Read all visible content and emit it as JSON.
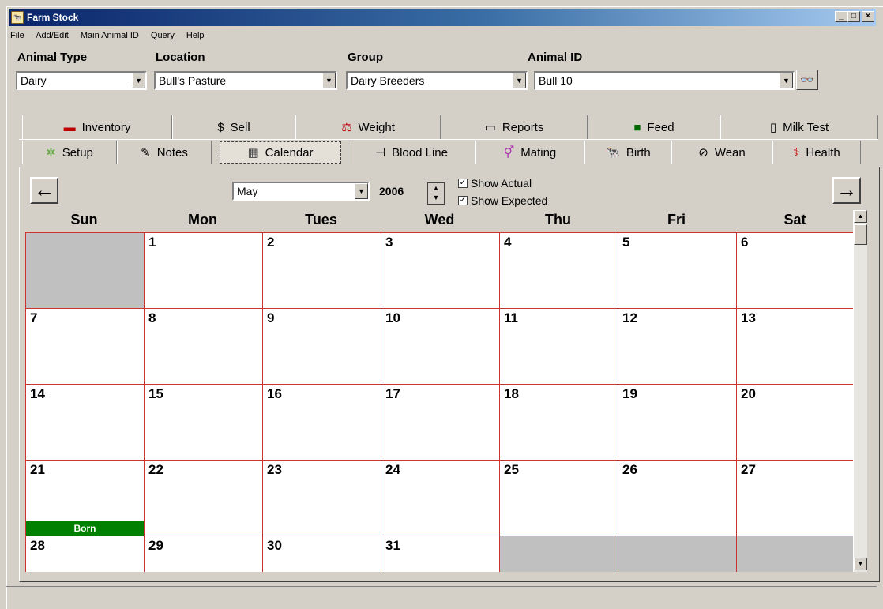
{
  "window": {
    "title": "Farm Stock"
  },
  "menu": [
    "File",
    "Add/Edit",
    "Main Animal ID",
    "Query",
    "Help"
  ],
  "filters": {
    "animal_type": {
      "label": "Animal Type",
      "value": "Dairy"
    },
    "location": {
      "label": "Location",
      "value": "Bull's Pasture"
    },
    "group": {
      "label": "Group",
      "value": "Dairy Breeders"
    },
    "animal_id": {
      "label": "Animal ID",
      "value": "Bull 10"
    }
  },
  "tabs_top": [
    "Inventory",
    "Sell",
    "Weight",
    "Reports",
    "Feed",
    "Milk Test"
  ],
  "tabs_bottom": [
    "Setup",
    "Notes",
    "Calendar",
    "Blood Line",
    "Mating",
    "Birth",
    "Wean",
    "Health"
  ],
  "calendar": {
    "month": "May",
    "year": "2006",
    "show_actual_label": "Show Actual",
    "show_expected_label": "Show Expected",
    "show_actual": true,
    "show_expected": true,
    "days": [
      "Sun",
      "Mon",
      "Tues",
      "Wed",
      "Thu",
      "Fri",
      "Sat"
    ],
    "weeks": [
      [
        "",
        "1",
        "2",
        "3",
        "4",
        "5",
        "6"
      ],
      [
        "7",
        "8",
        "9",
        "10",
        "11",
        "12",
        "13"
      ],
      [
        "14",
        "15",
        "16",
        "17",
        "18",
        "19",
        "20"
      ],
      [
        "21",
        "22",
        "23",
        "24",
        "25",
        "26",
        "27"
      ],
      [
        "28",
        "29",
        "30",
        "31",
        "",
        "",
        ""
      ]
    ],
    "event": {
      "day": "21",
      "label": "Born",
      "color": "#008000"
    }
  },
  "colors": {
    "grid_line": "#cc3333",
    "title_bar": "#0a246a"
  }
}
